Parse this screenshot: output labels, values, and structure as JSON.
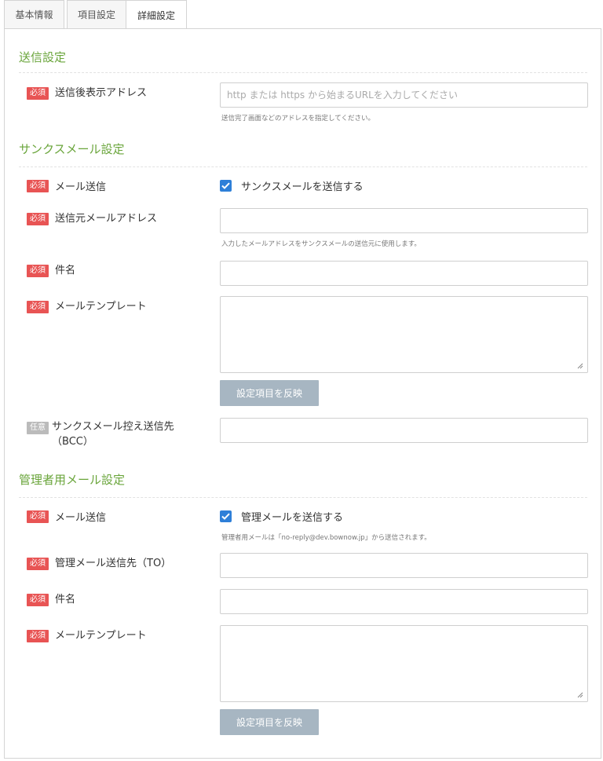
{
  "tabs": [
    {
      "label": "基本情報"
    },
    {
      "label": "項目設定"
    },
    {
      "label": "詳細設定"
    }
  ],
  "badges": {
    "required": "必須",
    "optional": "任意"
  },
  "send_settings": {
    "title": "送信設定",
    "redirect_address": {
      "label": "送信後表示アドレス",
      "placeholder": "http または https から始まるURLを入力してください",
      "value": "",
      "hint": "送信完了画面などのアドレスを指定してください。"
    }
  },
  "thanks_mail": {
    "title": "サンクスメール設定",
    "send": {
      "label": "メール送信",
      "checkbox_label": "サンクスメールを送信する",
      "checked": true
    },
    "from_address": {
      "label": "送信元メールアドレス",
      "value": "",
      "hint": "入力したメールアドレスをサンクスメールの送信元に使用します。"
    },
    "subject": {
      "label": "件名",
      "value": ""
    },
    "template": {
      "label": "メールテンプレート",
      "value": ""
    },
    "apply_button": "設定項目を反映",
    "bcc": {
      "label_line1": "サンクスメール控え送信先",
      "label_line2": "（BCC）",
      "value": ""
    }
  },
  "admin_mail": {
    "title": "管理者用メール設定",
    "send": {
      "label": "メール送信",
      "checkbox_label": "管理メールを送信する",
      "checked": true,
      "hint": "管理者用メールは「no-reply@dev.bownow.jp」から送信されます。"
    },
    "to_address": {
      "label": "管理メール送信先（TO）",
      "value": ""
    },
    "subject": {
      "label": "件名",
      "value": ""
    },
    "template": {
      "label": "メールテンプレート",
      "value": ""
    },
    "apply_button": "設定項目を反映"
  },
  "colors": {
    "section_title": "#6aa53b",
    "required_badge": "#e85454",
    "optional_badge": "#bbbbbb",
    "checkbox": "#2e7fd8",
    "button": "#a7b6c2"
  }
}
